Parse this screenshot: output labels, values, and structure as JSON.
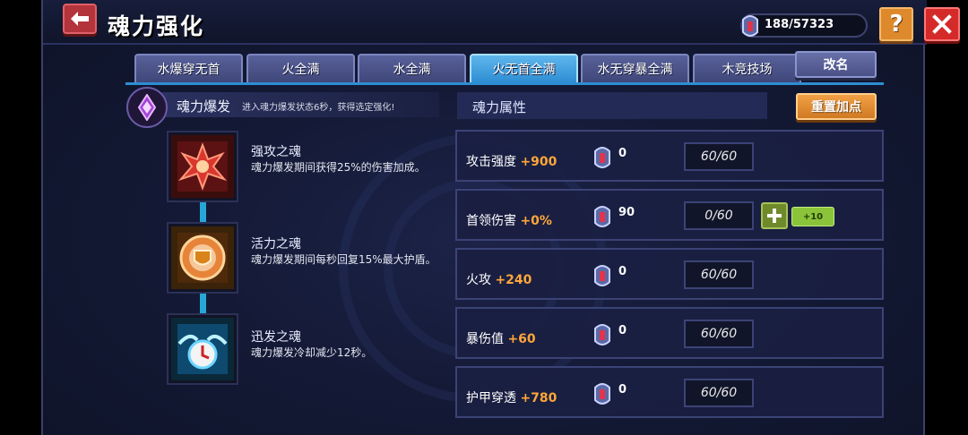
{
  "header": {
    "title": "魂力强化",
    "currency": "188/57323",
    "help_label": "?"
  },
  "tabs": [
    {
      "label": "水爆穿无首",
      "active": false
    },
    {
      "label": "火全满",
      "active": false
    },
    {
      "label": "水全满",
      "active": false
    },
    {
      "label": "火无首全满",
      "active": true
    },
    {
      "label": "水无穿暴全满",
      "active": false
    },
    {
      "label": "木竞技场",
      "active": false
    }
  ],
  "rename_label": "改名",
  "burst": {
    "title": "魂力爆发",
    "description": "进入魂力爆发状态6秒，获得选定强化!"
  },
  "souls": [
    {
      "name": "强攻之魂",
      "description": "魂力爆发期间获得25%的伤害加成。",
      "icon": "attack-soul-icon"
    },
    {
      "name": "活力之魂",
      "description": "魂力爆发期间每秒回复15%最大护盾。",
      "icon": "vitality-soul-icon"
    },
    {
      "name": "迅发之魂",
      "description": "魂力爆发冷却减少12秒。",
      "icon": "swift-soul-icon"
    }
  ],
  "attributes": {
    "title": "魂力属性",
    "reset_label": "重置加点",
    "rows": [
      {
        "label": "攻击强度",
        "bonus": "+900",
        "gems": "0",
        "progress": "60/60"
      },
      {
        "label": "首领伤害",
        "bonus": "+0%",
        "gems": "90",
        "progress": "0/60",
        "plus_label": "+",
        "plus10_label": "+10"
      },
      {
        "label": "火攻",
        "bonus": "+240",
        "gems": "0",
        "progress": "60/60"
      },
      {
        "label": "暴伤值",
        "bonus": "+60",
        "gems": "0",
        "progress": "60/60"
      },
      {
        "label": "护甲穿透",
        "bonus": "+780",
        "gems": "0",
        "progress": "60/60"
      }
    ]
  },
  "colors": {
    "active_tab": "#2e8ed3",
    "bonus": "#ffa63a",
    "close": "#d52a2a",
    "help": "#de8a2c",
    "reset": "#cf7a22"
  }
}
